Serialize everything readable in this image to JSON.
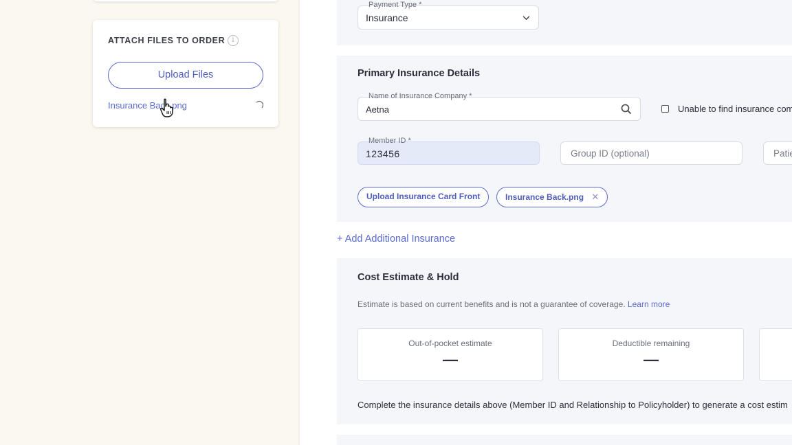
{
  "attach": {
    "title": "ATTACH FILES TO ORDER",
    "info_glyph": "i",
    "upload_label": "Upload Files",
    "file_name": "Insurance Back.png"
  },
  "payment": {
    "type_label": "Payment Type *",
    "type_value": "Insurance"
  },
  "primary": {
    "title": "Primary Insurance Details",
    "company_label": "Name of Insurance Company *",
    "company_value": "Aetna",
    "unable_label": "Unable to find insurance com",
    "member_label": "Member ID *",
    "member_value": "123456",
    "group_placeholder": "Group ID (optional)",
    "patient_placeholder": "Patie",
    "chip_front": "Upload Insurance Card Front",
    "chip_back": "Insurance Back.png"
  },
  "add_insurance": "+ Add Additional Insurance",
  "cost": {
    "title": "Cost Estimate & Hold",
    "note": "Estimate is based on current benefits and is not a guarantee of coverage.",
    "learn_more": "Learn more",
    "boxes": [
      {
        "label": "Out-of-pocket estimate",
        "value": "—"
      },
      {
        "label": "Deductible remaining",
        "value": "—"
      }
    ],
    "complete_note": "Complete the insurance details above (Member ID and Relationship to Policyholder) to generate a cost estim"
  },
  "colors": {
    "accent": "#5564c7",
    "page_bg": "#fbf8f0",
    "section_bg": "#f5f6f9",
    "member_field_bg": "#e5eaf8"
  },
  "icons": [
    "info-icon",
    "spinner-icon",
    "pointer-cursor-icon",
    "chevron-down-icon",
    "search-icon",
    "close-icon"
  ]
}
